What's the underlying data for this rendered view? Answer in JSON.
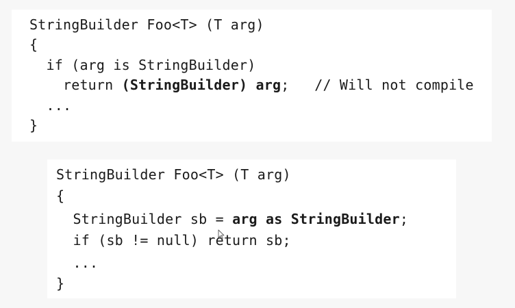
{
  "snippet_bad": {
    "line1": "StringBuilder Foo<T> (T arg)",
    "line2": "{",
    "line3": "  if (arg is StringBuilder)",
    "line4_pre": "    return ",
    "line4_bold": "(StringBuilder) arg",
    "line4_post": ";   // Will not compile",
    "line5": "  ...",
    "line6": "}"
  },
  "snippet_good": {
    "line1": "StringBuilder Foo<T> (T arg)",
    "line2": "{",
    "line3_pre": "  StringBuilder sb = ",
    "line3_bold": "arg as StringBuilder",
    "line3_post": ";",
    "line4": "  if (sb != null) return sb;",
    "line5": "  ...",
    "line6": "}"
  },
  "cursor": {
    "icon": "mouse-pointer-icon"
  }
}
